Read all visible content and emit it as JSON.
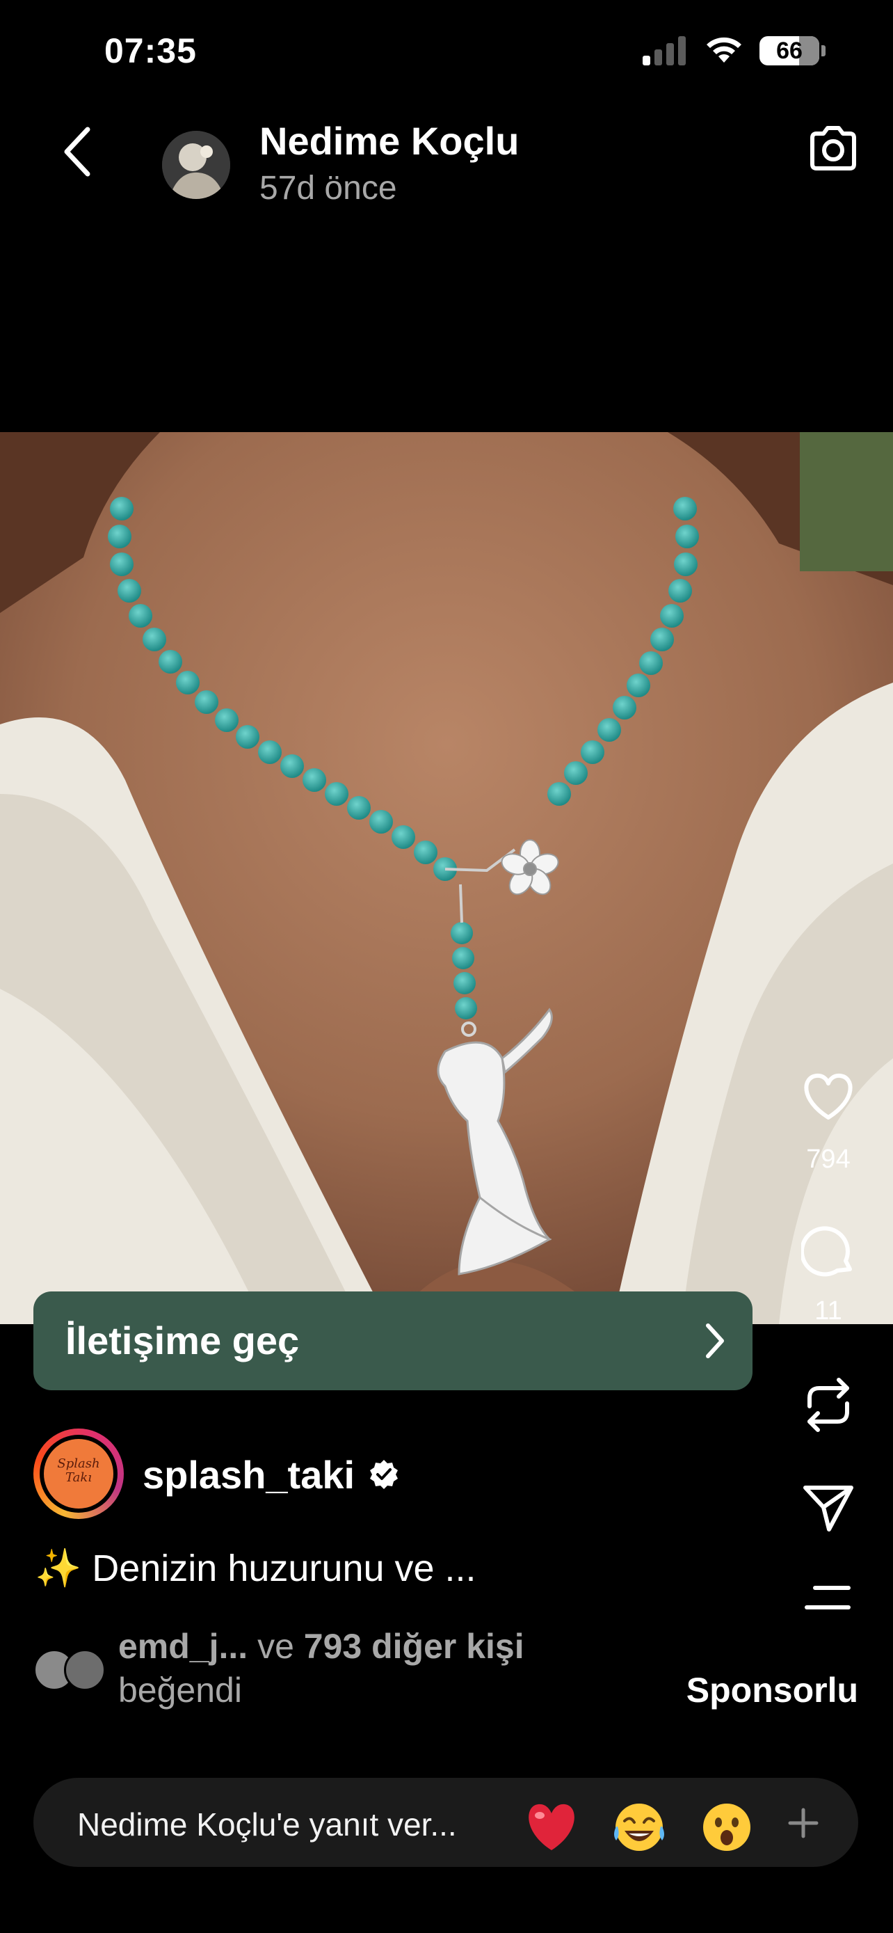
{
  "status_bar": {
    "time": "07:35",
    "battery": "66"
  },
  "header": {
    "author": "Nedime Koçlu",
    "time_ago": "57d önce",
    "back_icon": "chevron-left-icon",
    "camera_icon": "camera-icon"
  },
  "actions": {
    "like_count": "794",
    "comment_count": "11"
  },
  "cta": {
    "label": "İletişime geç"
  },
  "account": {
    "username": "splash_taki",
    "logo_text_1": "Splash",
    "logo_text_2": "Takı",
    "verified": true
  },
  "caption": {
    "text": "✨ Denizin huzurunu ve ..."
  },
  "likes": {
    "first": "emd_j...",
    "connector": " ve ",
    "others": "793 diğer kişi",
    "suffix": "beğendi"
  },
  "sponsored_label": "Sponsorlu",
  "reply": {
    "placeholder": "Nedime Koçlu'e yanıt ver...",
    "emojis": [
      "❤️",
      "😂",
      "😮"
    ]
  },
  "colors": {
    "background": "#000000",
    "cta": "#3a5a4c",
    "secondary_text": "#a8a8a8",
    "reply_bar": "#1b1b1b"
  }
}
